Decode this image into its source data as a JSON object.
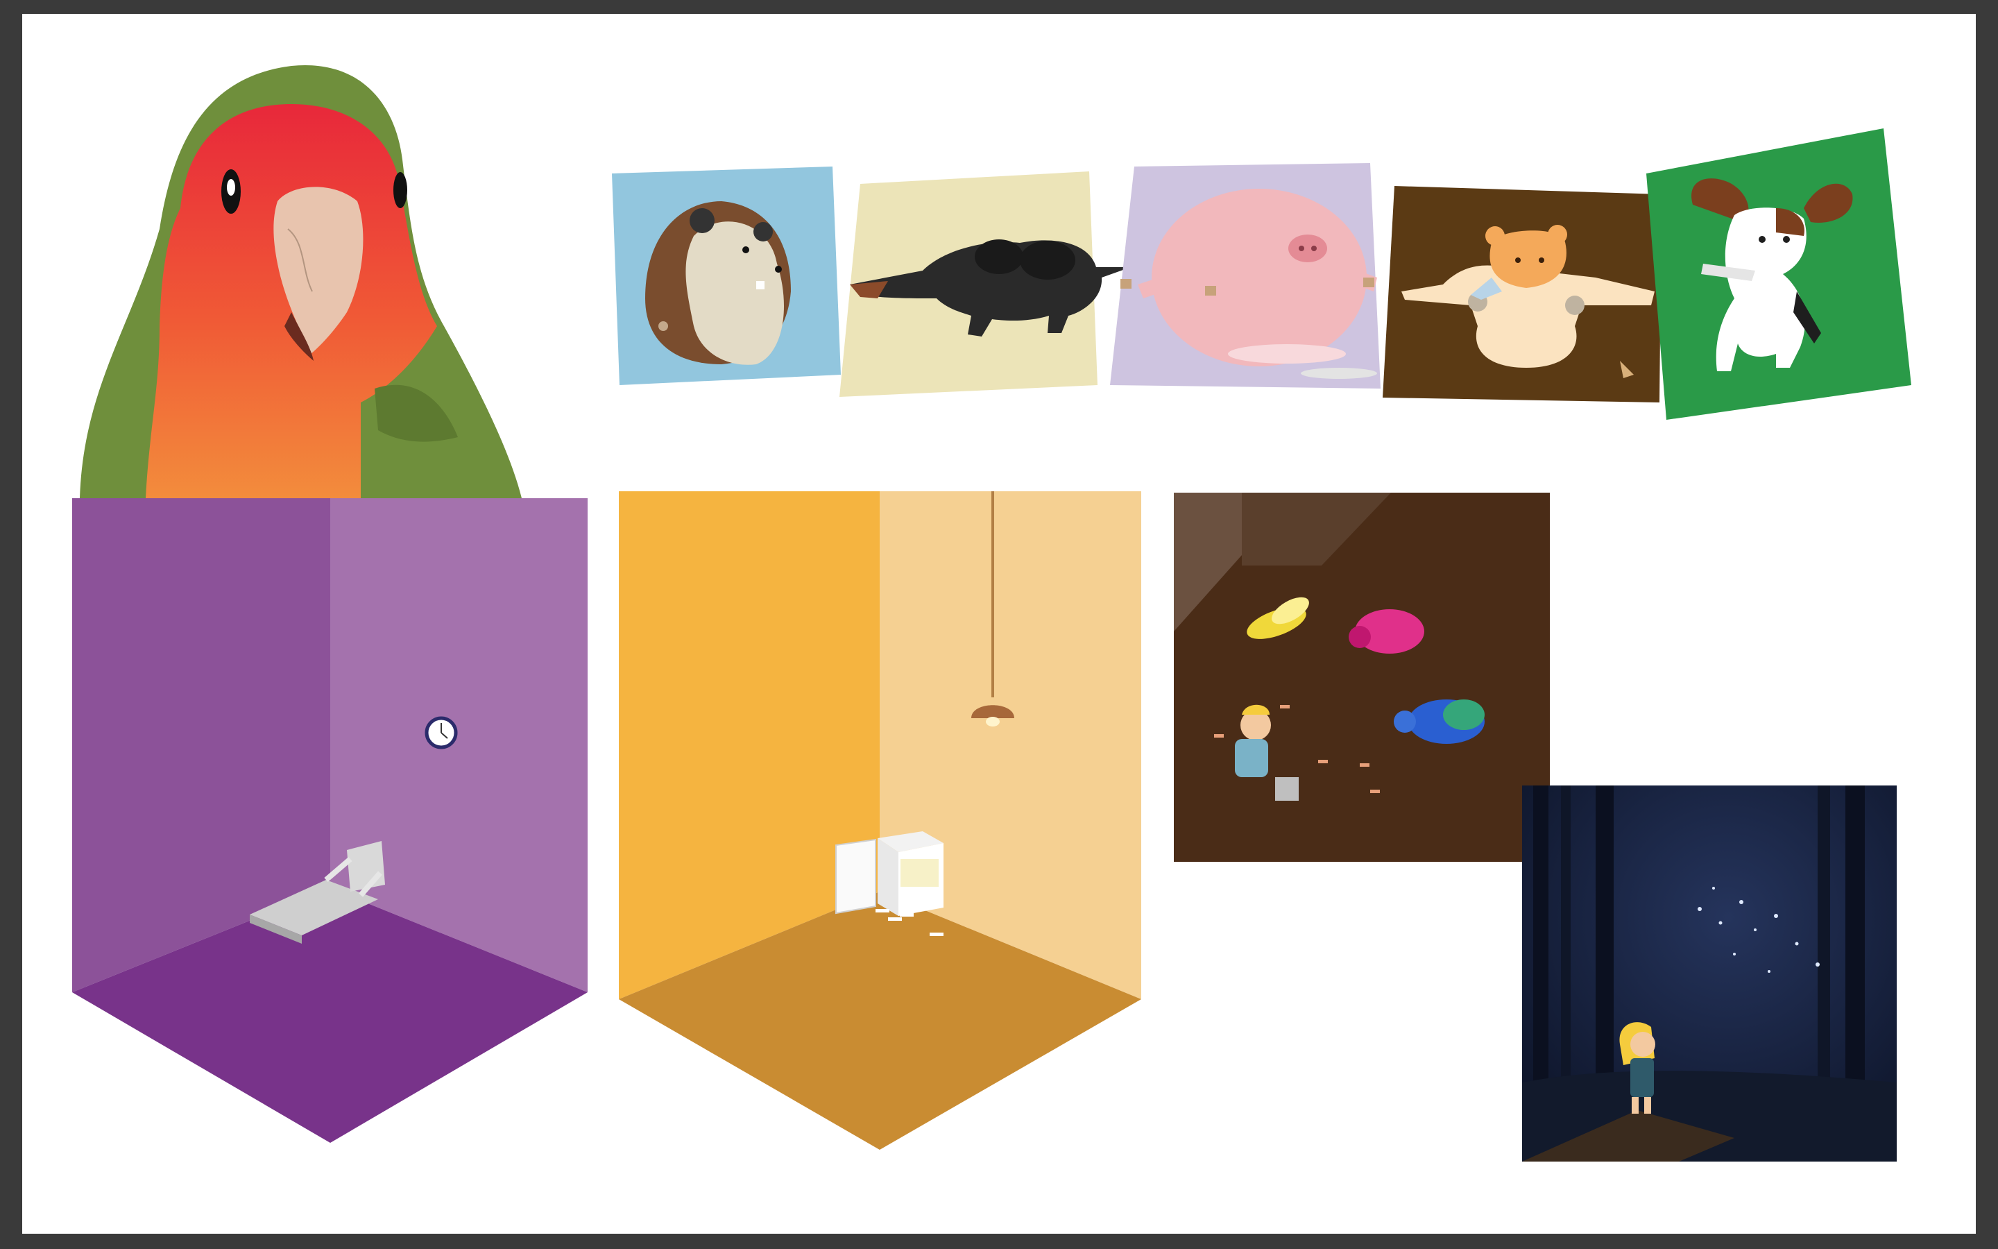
{
  "canvas": {
    "frame_color": "#3a3a3a",
    "paper_color": "#ffffff"
  },
  "illustrations": {
    "parrot": {
      "icon": "lovebird-parrot",
      "colors": {
        "green": "#6f8f3c",
        "red": "#e8283a",
        "orange": "#f08a3a",
        "beak": "#e8c4ae"
      }
    },
    "cards": [
      {
        "icon": "hedgehog",
        "bg": "#92c6de"
      },
      {
        "icon": "dachshund",
        "bg": "#ece4b8"
      },
      {
        "icon": "pig",
        "bg": "#cec4e0"
      },
      {
        "icon": "hamster-airplane",
        "bg": "#5b3a14"
      },
      {
        "icon": "basset-hound",
        "bg": "#2a9a48"
      }
    ],
    "rooms": [
      {
        "icon": "purple-room-treadmill",
        "left": "#8c5299",
        "right": "#a472ad",
        "floor": "#78338a"
      },
      {
        "icon": "orange-room-fridge",
        "left": "#f5b440",
        "right": "#f5d092",
        "floor": "#c98c32"
      }
    ],
    "scenes": [
      {
        "icon": "underground-bugs-scene",
        "bg": "#4a2c17"
      },
      {
        "icon": "night-forest-scene",
        "bg": "#16213a"
      }
    ]
  }
}
